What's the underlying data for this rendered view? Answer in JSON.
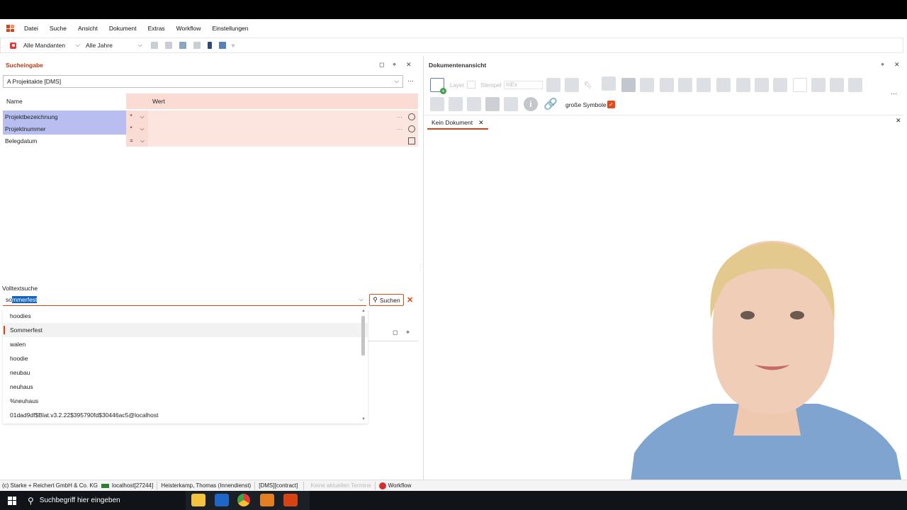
{
  "menu": [
    "Datei",
    "Suche",
    "Ansicht",
    "Dokument",
    "Extras",
    "Workflow",
    "Einstellungen"
  ],
  "toolbar": {
    "mandant": "Alle Mandanten",
    "jahr": "Alle Jahre"
  },
  "search_panel": {
    "title": "Sucheingabe",
    "template": "A Projektakte [DMS]",
    "col_name": "Name",
    "col_value": "Wert",
    "rows": [
      {
        "name": "Projektbezeichnung",
        "op": "*"
      },
      {
        "name": "Projektnummer",
        "op": "*"
      },
      {
        "name": "Belegdatum",
        "op": "="
      }
    ]
  },
  "fulltext": {
    "label": "Volltextsuche",
    "value_prefix": "so",
    "value_selected": "mmerfest",
    "search_button": "Suchen",
    "suggestions": [
      "hoodies",
      "Sommerfest",
      "walen",
      "hoodie",
      "neubau",
      "neuhaus",
      "%neuhaus",
      "01dad9df$Blat.v3.2.22$395790fd$30446ac5@localhost"
    ],
    "active_index": 1
  },
  "doc_view": {
    "title": "Dokumentenansicht",
    "layer_label": "Layer",
    "stamp_label": "Stempel",
    "stamp_value": "InEx",
    "big_symbols_label": "große Symbole",
    "tab_label": "Kein Dokument"
  },
  "status": {
    "company": "(c) Starke + Reichert GmbH & Co. KG",
    "host": "localhost[27244]",
    "user": "Heisterkamp, Thomas (Innendienst)",
    "context": "[DMS][contract]",
    "termine": "Keine aktuellen Termine",
    "workflow": "Workflow"
  },
  "taskbar": {
    "search_placeholder": "Suchbegriff hier eingeben"
  },
  "colors": {
    "accent": "#d84315",
    "selection": "#b8bff0",
    "salmon": "#fbdcd4"
  }
}
